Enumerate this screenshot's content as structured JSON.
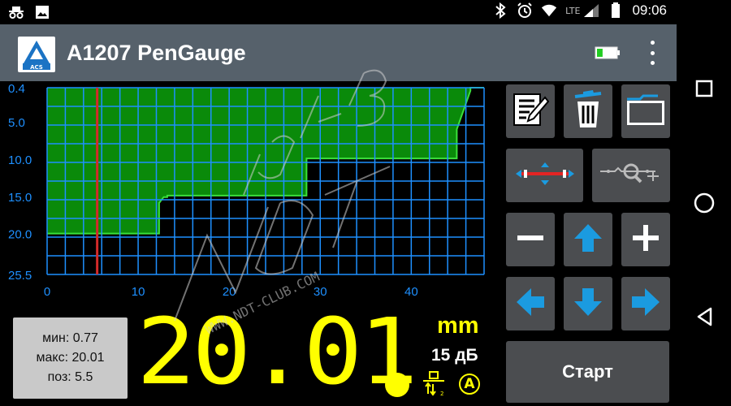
{
  "status_bar": {
    "time": "09:06",
    "network": "LTE",
    "icons": [
      "incognito-icon",
      "image-icon",
      "bluetooth-icon",
      "alarm-icon",
      "wifi-icon",
      "signal-icon",
      "battery-icon"
    ]
  },
  "app_bar": {
    "title": "A1207 PenGauge",
    "logo_text": "ACS",
    "battery_level": 0.3
  },
  "chart_data": {
    "type": "area",
    "y_tick_labels": [
      "0.4",
      "5.0",
      "10.0",
      "15.0",
      "20.0",
      "25.5"
    ],
    "x_tick_labels": [
      "0",
      "10",
      "20",
      "30",
      "40"
    ],
    "xlim": [
      0,
      48
    ],
    "ylim": [
      0.4,
      25.5
    ],
    "y_inverted": true,
    "grid": true,
    "cursor_x": 5.5,
    "x": [
      0,
      12.3,
      12.3,
      12.8,
      13.2,
      13.2,
      28.5,
      28.5,
      45,
      45,
      46.5,
      46.5,
      48
    ],
    "y": [
      20.0,
      20.0,
      15.9,
      15.1,
      15.1,
      14.9,
      14.9,
      9.9,
      9.9,
      6.0,
      0.8,
      0.4,
      0.4
    ],
    "colors": {
      "fill": "#0a8a0a",
      "grid": "#1e90ff",
      "cursor": "#d42a2a",
      "axis_text": "#1e90ff"
    }
  },
  "stats": {
    "min_label": "мин: 0.77",
    "max_label": "макс: 20.01",
    "pos_label": "поз: 5.5"
  },
  "reading": {
    "value": "20.01",
    "unit": "mm",
    "gain": "15 дБ",
    "mode": "A"
  },
  "controls": {
    "start_label": "Старт",
    "buttons": [
      "edit-icon",
      "trash-icon",
      "folder-icon",
      "gate-width-icon",
      "zoom-icon",
      "minus-icon",
      "arrow-up-icon",
      "plus-icon",
      "arrow-left-icon",
      "arrow-down-icon",
      "arrow-right-icon"
    ]
  },
  "watermark": {
    "logo": "NDT-CLUB",
    "url": "WWW.NDT-CLUB.COM"
  },
  "colors": {
    "accent": "#1b9be0",
    "value": "#ffff00",
    "panel": "#4b4d50",
    "appbar": "#56616b"
  }
}
